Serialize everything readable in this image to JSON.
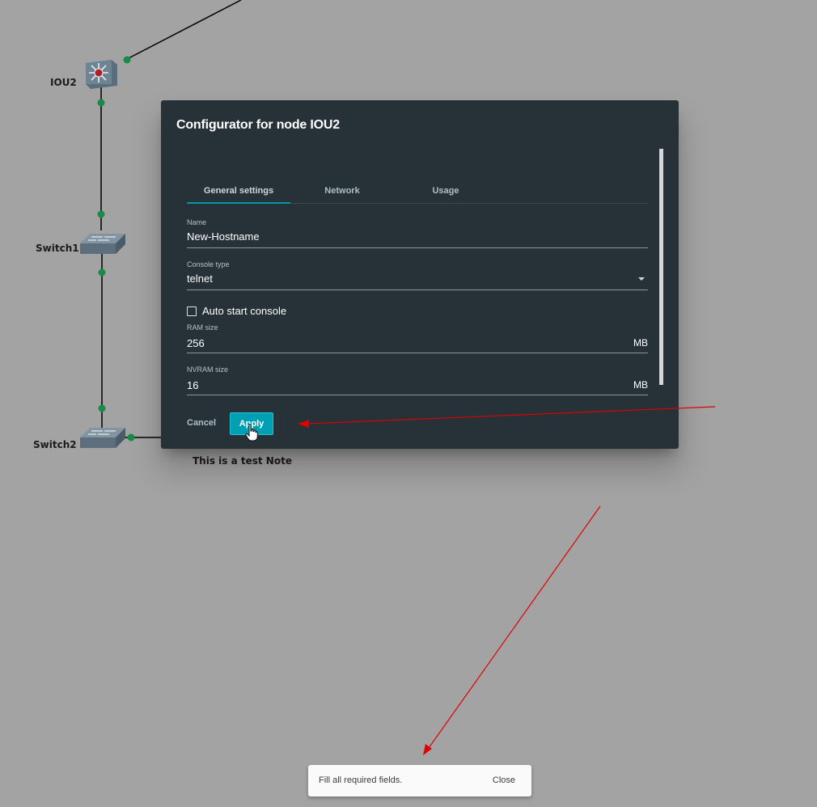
{
  "topology": {
    "nodes": [
      {
        "label": "IOU2",
        "icon": "multilayer-switch-icon"
      },
      {
        "label": "Switch1",
        "icon": "ethernet-switch-icon"
      },
      {
        "label": "Switch2",
        "icon": "ethernet-switch-icon"
      }
    ],
    "note": "This is a test Note",
    "link_color": "#000000",
    "port_indicator_color": "#1a8a48"
  },
  "dialog": {
    "title": "Configurator for node IOU2",
    "tabs": [
      {
        "label": "General settings",
        "active": true
      },
      {
        "label": "Network",
        "active": false
      },
      {
        "label": "Usage",
        "active": false
      }
    ],
    "fields": {
      "name": {
        "label": "Name",
        "value": "New-Hostname"
      },
      "console_type": {
        "label": "Console type",
        "value": "telnet"
      },
      "auto_start_console": {
        "label": "Auto start console",
        "checked": false
      },
      "ram_size": {
        "label": "RAM size",
        "value": "256",
        "unit": "MB"
      },
      "nvram_size": {
        "label": "NVRAM size",
        "value": "16",
        "unit": "MB"
      }
    },
    "cancel_label": "Cancel",
    "apply_label": "Apply",
    "accent_color": "#00a0b4",
    "background_color": "#263238"
  },
  "snackbar": {
    "message": "Fill all required fields.",
    "close_label": "Close"
  },
  "annotation_arrow_color": "#e00000"
}
